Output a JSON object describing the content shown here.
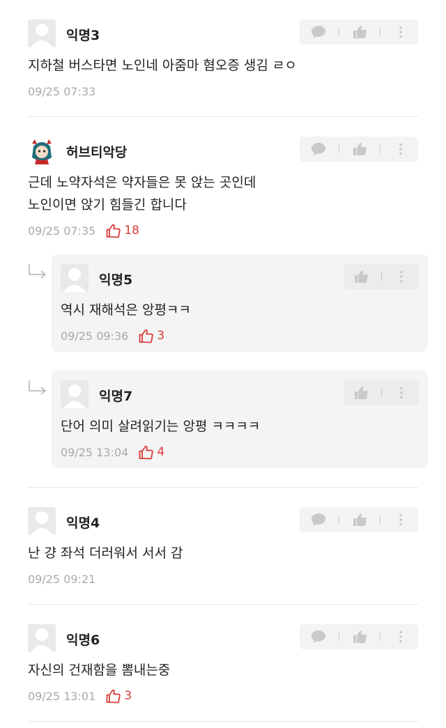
{
  "comments": [
    {
      "nick": "익명3",
      "avatar": "anonymous",
      "text": "지하철 버스타면 노인네 아줌마 혐오증 생김 ㄹㅇ",
      "time": "09/25 07:33",
      "likes": null
    },
    {
      "nick": "허브티악당",
      "avatar": "anime-character",
      "text": "근데 노약자석은 약자들은 못 앉는 곳인데\n노인이면 앉기 힘들긴 합니다",
      "time": "09/25 07:35",
      "likes": "18",
      "replies": [
        {
          "nick": "익명5",
          "text": "역시 재해석은 앙평ㅋㅋ",
          "time": "09/25 09:36",
          "likes": "3"
        },
        {
          "nick": "익명7",
          "text": "단어 의미 살려읽기는 앙평 ㅋㅋㅋㅋ",
          "time": "09/25 13:04",
          "likes": "4"
        }
      ]
    },
    {
      "nick": "익명4",
      "avatar": "anonymous",
      "text": "난 걍 좌석 더러워서 서서 감",
      "time": "09/25 09:21",
      "likes": null
    },
    {
      "nick": "익명6",
      "avatar": "anonymous",
      "text": "자신의 건재함을 뽐내는중",
      "time": "09/25 13:01",
      "likes": "3"
    }
  ],
  "colors": {
    "like": "#d93a3a",
    "meta": "#a9a9a9",
    "divider": "#e6e6e6",
    "reply_bg": "#f4f4f4"
  },
  "icons": {
    "reply": "speech-bubble-icon",
    "like": "thumbs-up-icon",
    "more": "more-vertical-icon",
    "reply_indicator": "reply-arrow-icon"
  }
}
